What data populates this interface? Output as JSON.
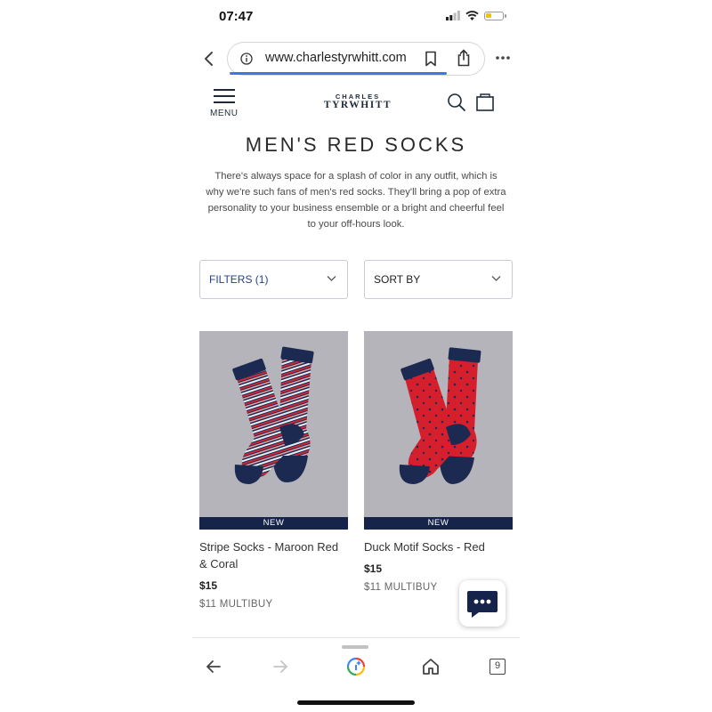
{
  "status_bar": {
    "time": "07:47"
  },
  "browser": {
    "url": "www.charlestyrwhitt.com",
    "tab_count": "9",
    "icons": [
      "back-chevron-icon",
      "info-icon",
      "bookmark-icon",
      "share-icon",
      "more-icon",
      "back-arrow-icon",
      "forward-arrow-icon",
      "google-assistant-icon",
      "home-icon",
      "tabs-icon"
    ]
  },
  "site_header": {
    "menu_label": "MENU",
    "logo_top": "CHARLES",
    "logo_bottom": "TYRWHITT",
    "icons": [
      "search-icon",
      "bag-icon"
    ]
  },
  "page": {
    "title": "MEN'S RED SOCKS",
    "intro": "There's always space for a splash of color in any outfit, which is why we're such fans of men's red socks. They'll bring a pop of extra personality to your business ensemble or a bright and cheerful feel to your off-hours look."
  },
  "filters": {
    "filter_label": "FILTERS (1)",
    "sort_label": "SORT BY"
  },
  "products": [
    {
      "badge": "NEW",
      "name": "Stripe Socks - Maroon Red & Coral",
      "price": "$15",
      "multibuy": "$11 MULTIBUY"
    },
    {
      "badge": "NEW",
      "name": "Duck Motif Socks - Red",
      "price": "$15",
      "multibuy": "$11 MULTIBUY"
    }
  ],
  "colors": {
    "navy": "#16234a",
    "accent_blue": "#3b78e7",
    "sock_red": "#d61f2c",
    "image_bg": "#b4b4ba"
  }
}
